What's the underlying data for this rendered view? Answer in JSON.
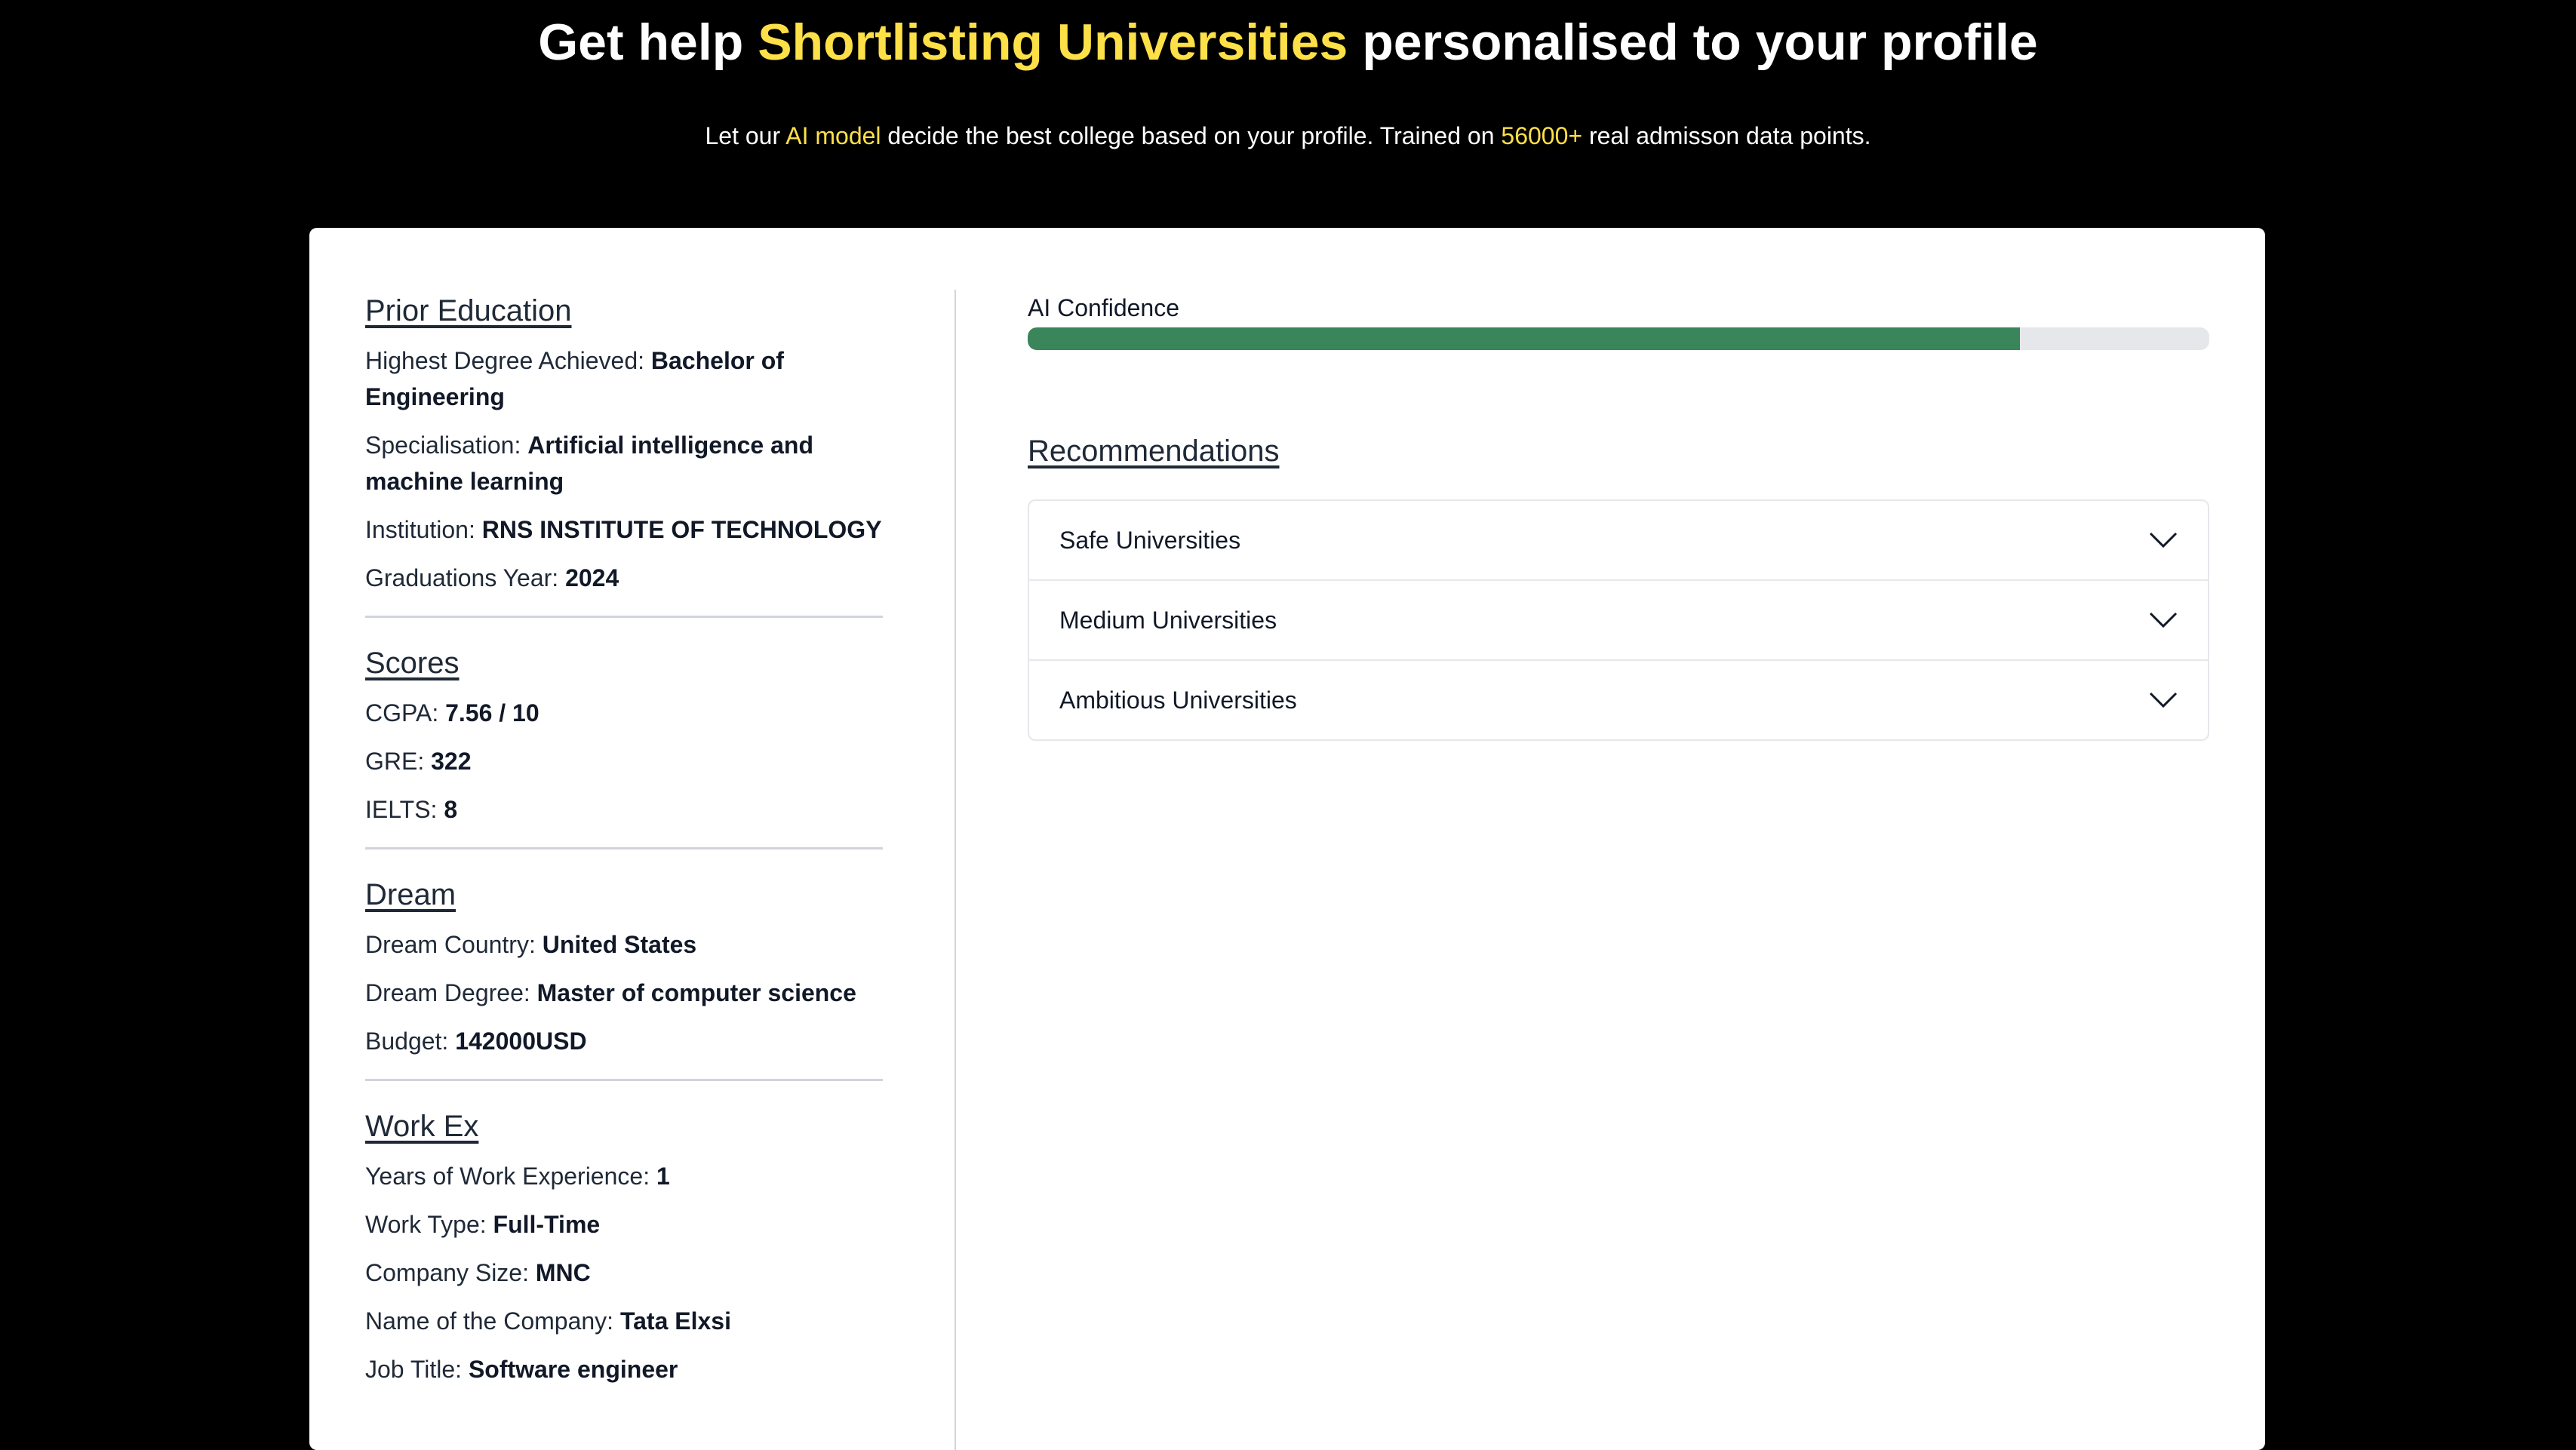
{
  "hero": {
    "title_pre": "Get help ",
    "title_highlight": "Shortlisting Universities",
    "title_post": " personalised to your profile",
    "sub_1": "Let our ",
    "sub_hl_1": "AI model",
    "sub_2": " decide the best college based on your profile. Trained on ",
    "sub_hl_2": "56000+",
    "sub_3": " real admisson data points."
  },
  "profile": {
    "prior_education": {
      "title": "Prior Education",
      "fields": [
        {
          "label": "Highest Degree Achieved: ",
          "value": "Bachelor of Engineering"
        },
        {
          "label": "Specialisation: ",
          "value": "Artificial intelligence and machine learning"
        },
        {
          "label": "Institution: ",
          "value": "RNS INSTITUTE OF TECHNOLOGY"
        },
        {
          "label": "Graduations Year: ",
          "value": "2024"
        }
      ]
    },
    "scores": {
      "title": "Scores",
      "fields": [
        {
          "label": "CGPA: ",
          "value": "7.56 / 10"
        },
        {
          "label": "GRE: ",
          "value": "322"
        },
        {
          "label": "IELTS: ",
          "value": "8"
        }
      ]
    },
    "dream": {
      "title": "Dream",
      "fields": [
        {
          "label": "Dream Country: ",
          "value": "United States"
        },
        {
          "label": "Dream Degree: ",
          "value": "Master of computer science"
        },
        {
          "label": "Budget: ",
          "value": "142000USD"
        }
      ]
    },
    "work_ex": {
      "title": "Work Ex",
      "fields": [
        {
          "label": "Years of Work Experience: ",
          "value": "1"
        },
        {
          "label": "Work Type: ",
          "value": "Full-Time"
        },
        {
          "label": "Company Size: ",
          "value": "MNC"
        },
        {
          "label": "Name of the Company: ",
          "value": "Tata Elxsi"
        },
        {
          "label": "Job Title: ",
          "value": "Software engineer"
        }
      ]
    }
  },
  "confidence": {
    "label": "AI Confidence",
    "fraction": 0.84,
    "color": "#3a8559"
  },
  "recommendations": {
    "title": "Recommendations",
    "items": [
      {
        "label": "Safe Universities",
        "icon": "chevron-down-icon"
      },
      {
        "label": "Medium Universities",
        "icon": "chevron-down-icon"
      },
      {
        "label": "Ambitious Universities",
        "icon": "chevron-down-icon"
      }
    ]
  },
  "colors": {
    "highlight": "#fde047",
    "background": "#000000"
  }
}
